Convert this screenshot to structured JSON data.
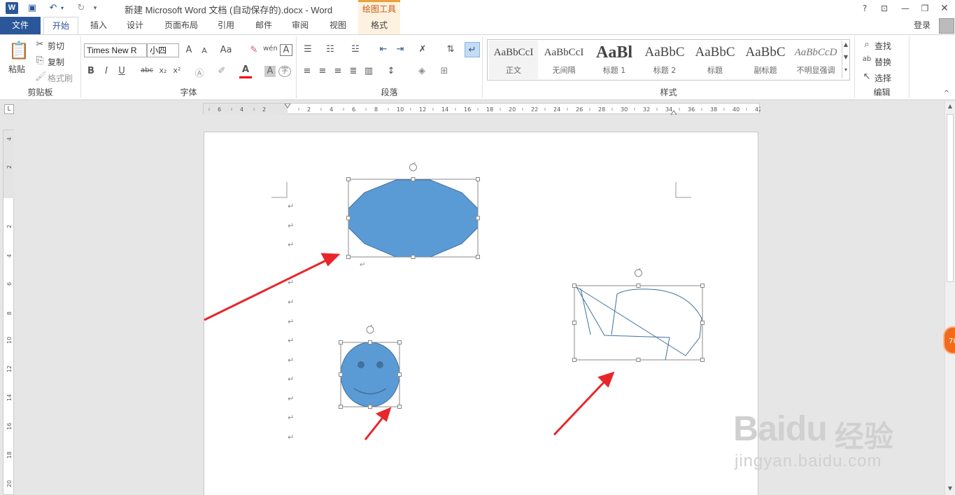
{
  "title_bar": {
    "app_letter": "W",
    "document_title": "新建 Microsoft Word 文档 (自动保存的).docx - Word",
    "contextual_tab_group": "绘图工具",
    "help": "?",
    "ribbon_display": "⊡",
    "minimize": "—",
    "restore": "❐"
  },
  "tabs": {
    "file": "文件",
    "items": [
      "开始",
      "插入",
      "设计",
      "页面布局",
      "引用",
      "邮件",
      "审阅",
      "视图",
      "格式"
    ],
    "active": "开始",
    "account": "登录"
  },
  "ribbon": {
    "clipboard": {
      "label": "剪贴板",
      "paste": "粘贴",
      "cut": "剪切",
      "copy": "复制",
      "format_painter": "格式刷"
    },
    "font": {
      "label": "字体",
      "font_name": "Times New R",
      "font_size": "小四",
      "grow": "A",
      "shrink": "A",
      "case": "Aa",
      "bold": "B",
      "italic": "I",
      "underline": "U",
      "strike": "abc",
      "subscript": "x₂",
      "superscript": "x²",
      "font_color_letter": "A",
      "wen": "wén",
      "highlight_letter": "A",
      "circle_char": "字"
    },
    "paragraph": {
      "label": "段落"
    },
    "styles": {
      "label": "样式",
      "items": [
        {
          "preview": "AaBbCcI",
          "name": "正文"
        },
        {
          "preview": "AaBbCcI",
          "name": "无间隔"
        },
        {
          "preview": "AaBl",
          "name": "标题 1"
        },
        {
          "preview": "AaBbC",
          "name": "标题 2"
        },
        {
          "preview": "AaBbC",
          "name": "标题"
        },
        {
          "preview": "AaBbC",
          "name": "副标题"
        },
        {
          "preview": "AaBbCcD",
          "name": "不明显强调"
        }
      ]
    },
    "editing": {
      "label": "编辑",
      "find": "查找",
      "replace": "替换",
      "select": "选择"
    }
  },
  "rulers": {
    "horizontal_ticks": [
      "6",
      "4",
      "2",
      "2",
      "4",
      "6",
      "8",
      "10",
      "12",
      "14",
      "16",
      "18",
      "20",
      "22",
      "24",
      "26",
      "28",
      "30",
      "32",
      "34",
      "36",
      "38",
      "40",
      "42"
    ],
    "vertical_ticks": [
      "4",
      "2",
      "2",
      "4",
      "6",
      "8",
      "10",
      "12",
      "14",
      "16",
      "18",
      "20"
    ]
  },
  "document": {
    "paragraph_mark": "↵"
  },
  "side_badge": "78",
  "watermark": {
    "logo": "Baidu",
    "suffix": "经验",
    "url": "jingyan.baidu.com"
  },
  "colors": {
    "word_blue": "#2b579a",
    "shape_fill": "#5b9bd5",
    "shape_stroke": "#41719c",
    "arrow_red": "#e8262a",
    "contextual_orange": "#c55a11"
  }
}
